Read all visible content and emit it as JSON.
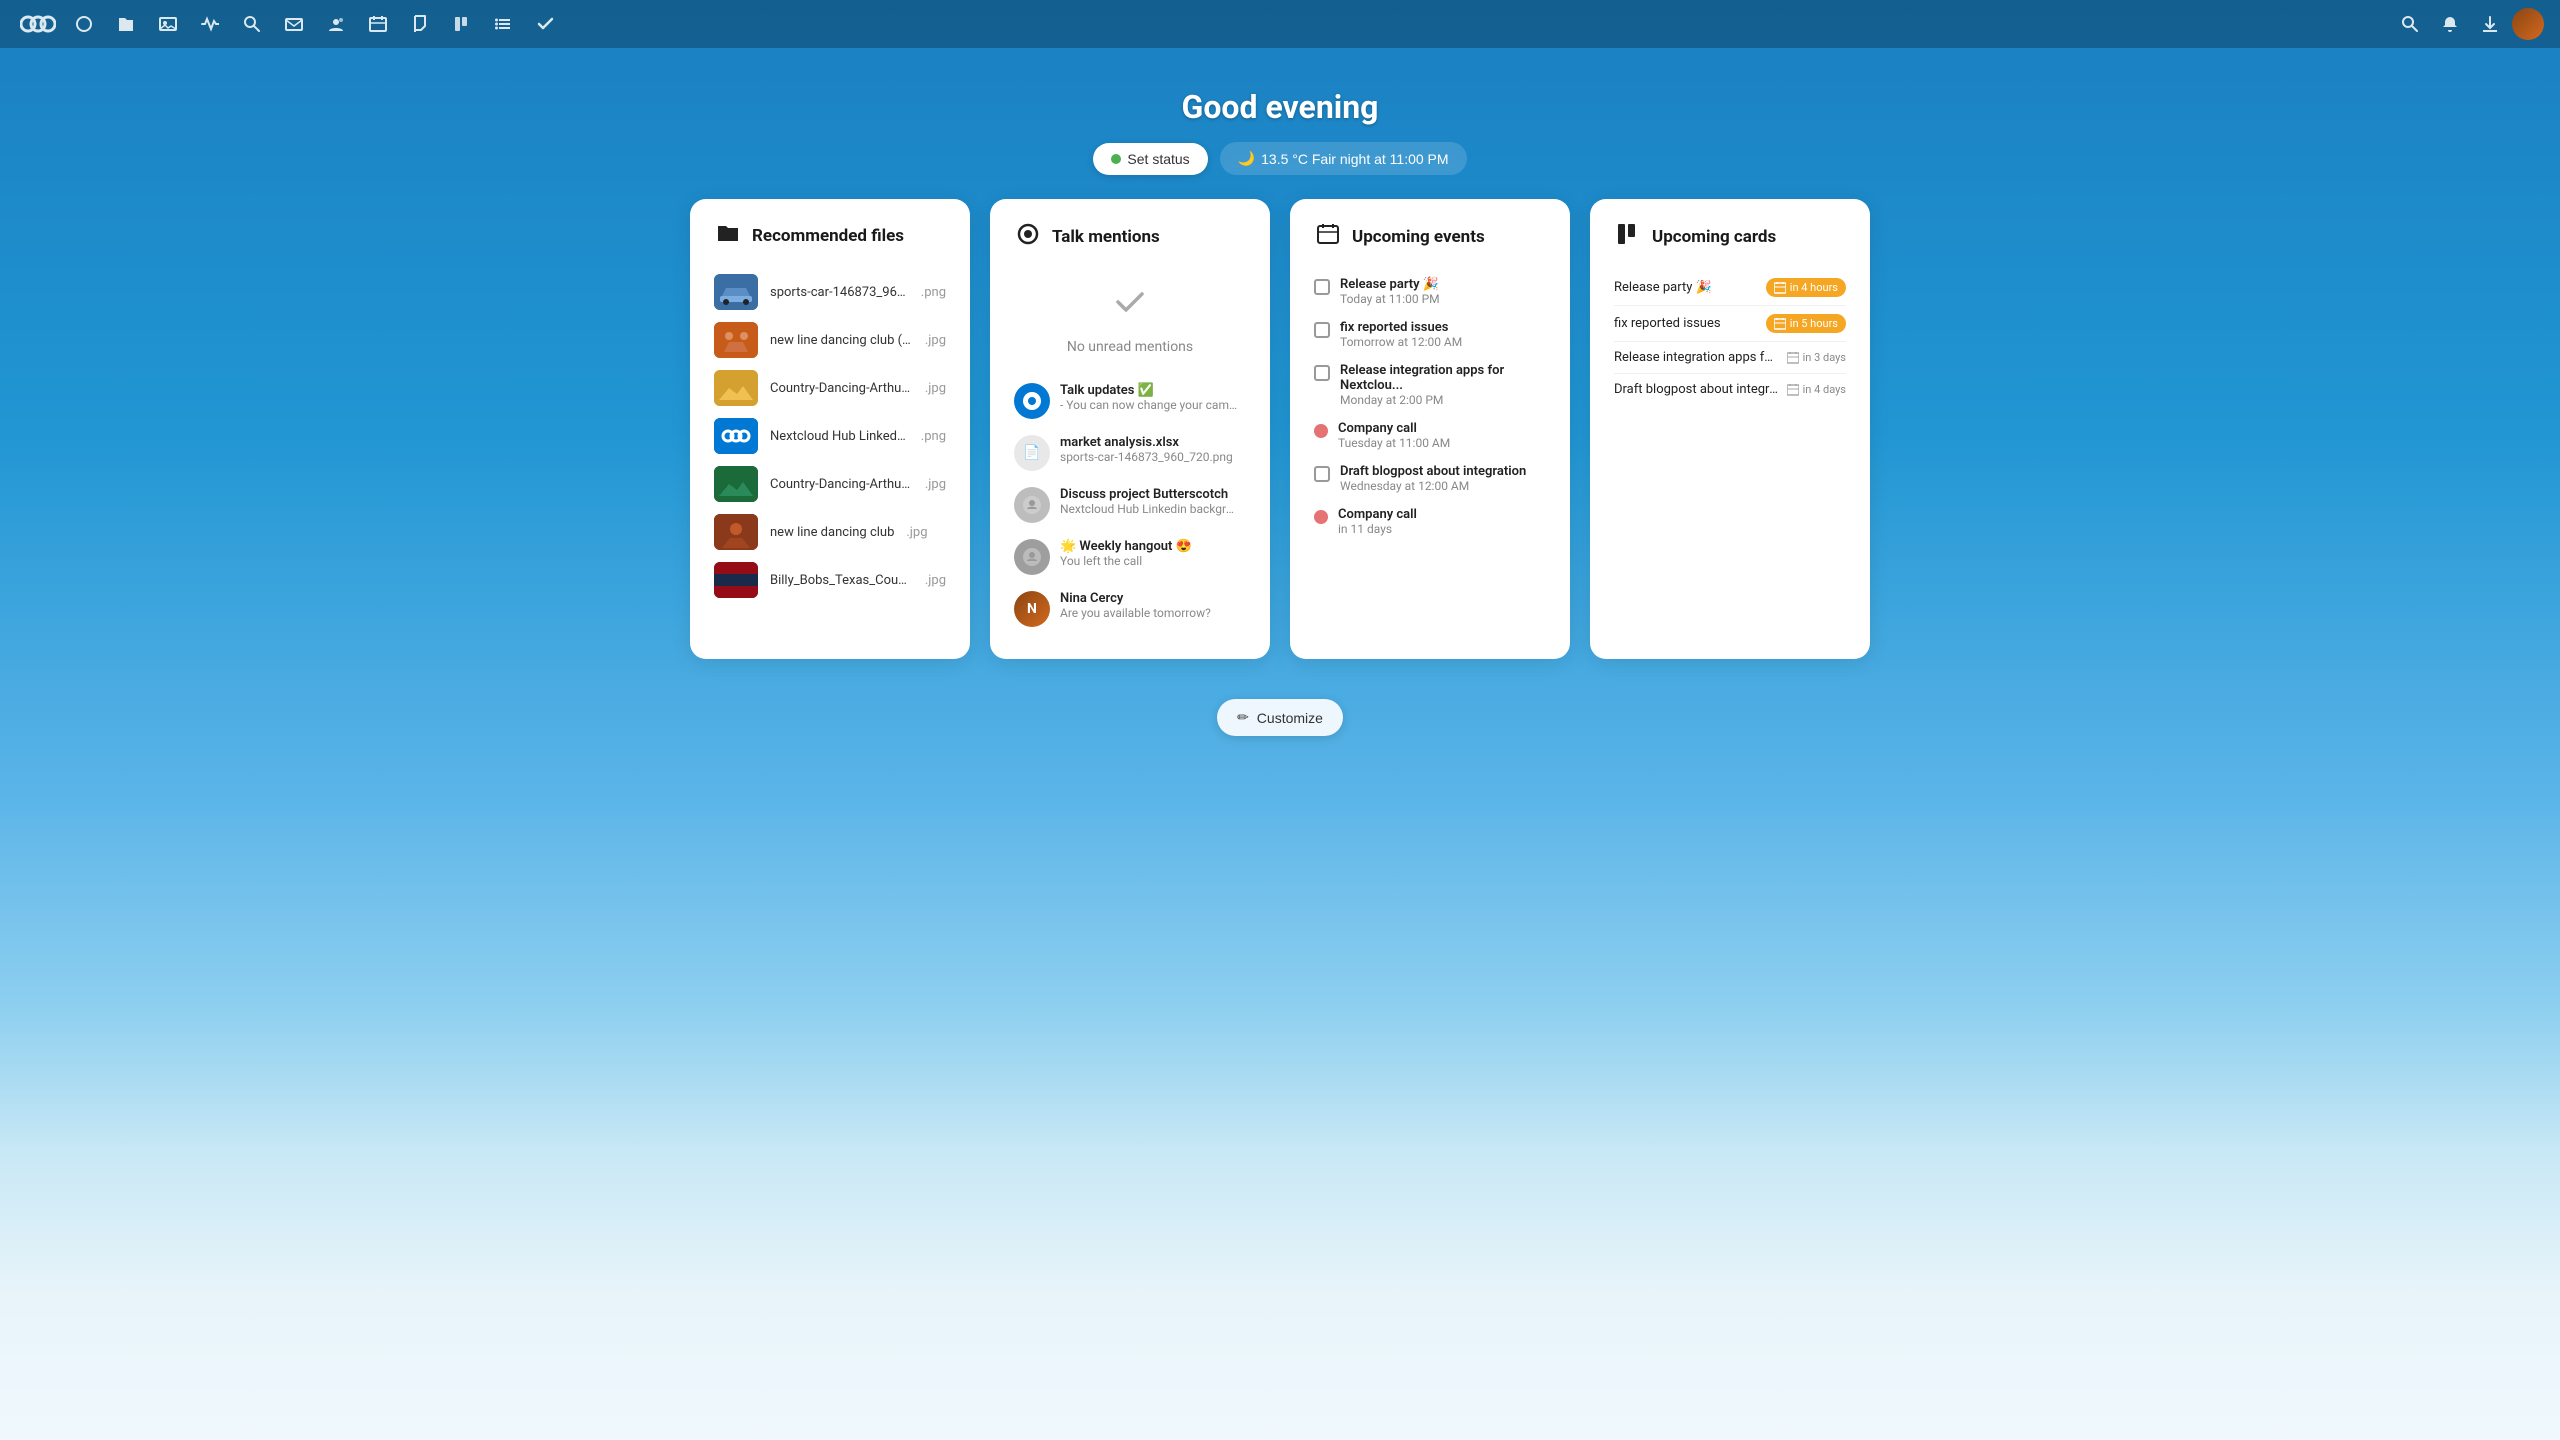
{
  "app": {
    "title": "Nextcloud"
  },
  "navbar": {
    "icons": [
      "●●●",
      "○",
      "📁",
      "🖼",
      "⚡",
      "🔍",
      "✉",
      "👥",
      "📅",
      "✏",
      "💼",
      "≡",
      "✓"
    ]
  },
  "greeting": {
    "title": "Good evening",
    "set_status_label": "Set status",
    "weather_label": "13.5 °C Fair night at 11:00 PM",
    "weather_emoji": "🌙"
  },
  "recommended_files": {
    "title": "Recommended files",
    "items": [
      {
        "name": "sports-car-146873_960_7...",
        "ext": ".png",
        "thumb_class": "thumb-car"
      },
      {
        "name": "new line dancing club (2)",
        "ext": ".jpg",
        "thumb_class": "thumb-dance1"
      },
      {
        "name": "Country-Dancing-Arthur_...",
        "ext": ".jpg",
        "thumb_class": "thumb-dance2"
      },
      {
        "name": "Nextcloud Hub Linkedin b...",
        "ext": ".png",
        "thumb_class": "thumb-nc"
      },
      {
        "name": "Country-Dancing-Arthur_...",
        "ext": ".jpg",
        "thumb_class": "thumb-dance3"
      },
      {
        "name": "new line dancing club",
        "ext": ".jpg",
        "thumb_class": "thumb-dance4"
      },
      {
        "name": "Billy_Bobs_Texas_Countr...",
        "ext": ".jpg",
        "thumb_class": "thumb-texas"
      }
    ]
  },
  "talk_mentions": {
    "title": "Talk mentions",
    "no_mentions_text": "No unread mentions",
    "items": [
      {
        "sender": "Talk updates ✅",
        "preview": "- You can now change your camer...",
        "avatar_color": "#0078d4",
        "avatar_text": "T",
        "is_app": true
      },
      {
        "sender": "market analysis.xlsx",
        "preview": "sports-car-146873_960_720.png",
        "avatar_color": "#e0e0e0",
        "avatar_text": "📄",
        "is_app": false
      },
      {
        "sender": "Discuss project Butterscotch",
        "preview": "Nextcloud Hub Linkedin backgrou...",
        "avatar_color": "#bdbdbd",
        "avatar_text": "💬",
        "is_app": false
      },
      {
        "sender": "🌟 Weekly hangout 😍",
        "preview": "You left the call",
        "avatar_color": "#9e9e9e",
        "avatar_text": "🌟",
        "is_app": false
      },
      {
        "sender": "Nina Cercy",
        "preview": "Are you available tomorrow?",
        "avatar_color": "#8B4513",
        "avatar_text": "N",
        "is_avatar": true
      }
    ]
  },
  "upcoming_events": {
    "title": "Upcoming events",
    "items": [
      {
        "title": "Release party 🎉",
        "time": "Today at 11:00 PM",
        "type": "checkbox",
        "dot_color": null
      },
      {
        "title": "fix reported issues",
        "time": "Tomorrow at 12:00 AM",
        "type": "checkbox",
        "dot_color": null
      },
      {
        "title": "Release integration apps for Nextclou...",
        "time": "Monday at 2:00 PM",
        "type": "checkbox",
        "dot_color": null
      },
      {
        "title": "Company call",
        "time": "Tuesday at 11:00 AM",
        "type": "dot",
        "dot_color": "#e57373"
      },
      {
        "title": "Draft blogpost about integration",
        "time": "Wednesday at 12:00 AM",
        "type": "checkbox",
        "dot_color": null
      },
      {
        "title": "Company call",
        "time": "in 11 days",
        "type": "dot",
        "dot_color": "#e57373"
      }
    ]
  },
  "upcoming_cards": {
    "title": "Upcoming cards",
    "items": [
      {
        "title": "Release party 🎉",
        "badge_text": "in 4 hours",
        "badge_type": "yellow"
      },
      {
        "title": "fix reported issues",
        "badge_text": "in 5 hours",
        "badge_type": "yellow"
      },
      {
        "title": "Release integration apps for...",
        "badge_text": "in 3 days",
        "badge_type": "gray"
      },
      {
        "title": "Draft blogpost about integra...",
        "badge_text": "in 4 days",
        "badge_type": "gray"
      }
    ]
  },
  "customize": {
    "label": "Customize"
  }
}
